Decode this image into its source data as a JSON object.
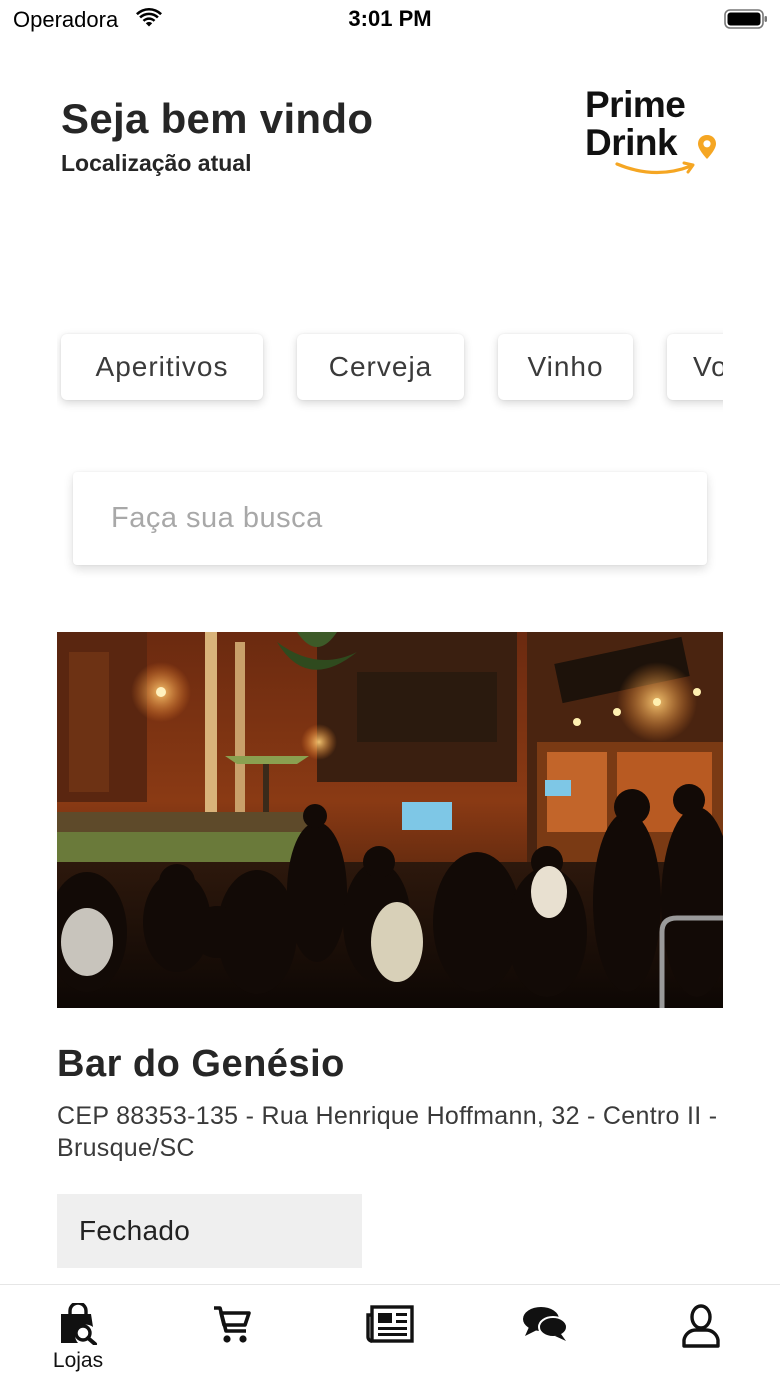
{
  "status_bar": {
    "carrier": "Operadora",
    "time": "3:01 PM",
    "wifi_icon": "wifi-icon",
    "battery_icon": "battery-icon"
  },
  "header": {
    "greeting": "Seja bem vindo",
    "location_label": "Localização atual",
    "logo": {
      "line1": "Prime",
      "line2": "Drink",
      "accent_color": "#f5a623"
    }
  },
  "categories": [
    {
      "label": "Aperitivos"
    },
    {
      "label": "Cerveja"
    },
    {
      "label": "Vinho"
    },
    {
      "label": "Vo"
    }
  ],
  "search": {
    "placeholder": "Faça sua busca",
    "value": ""
  },
  "store": {
    "name": "Bar do Genésio",
    "address": "CEP 88353-135 - Rua Henrique Hoffmann, 32 - Centro II - Brusque/SC",
    "status": "Fechado",
    "image_icon": "bar-photo"
  },
  "tab_bar": {
    "items": [
      {
        "icon": "store-bag-icon",
        "label": "Lojas",
        "active": true
      },
      {
        "icon": "cart-icon",
        "label": ""
      },
      {
        "icon": "newspaper-icon",
        "label": ""
      },
      {
        "icon": "chat-icon",
        "label": ""
      },
      {
        "icon": "user-icon",
        "label": ""
      }
    ]
  }
}
